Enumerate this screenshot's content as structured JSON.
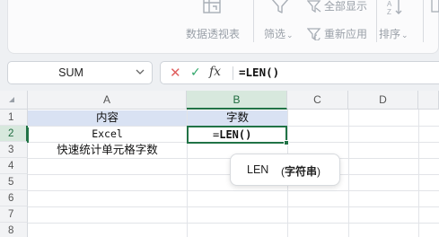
{
  "ribbon": {
    "pivot_label": "数据透视表",
    "filter_label": "筛选",
    "show_all_label": "全部显示",
    "reapply_label": "重新应用",
    "sort_label": "排序",
    "dropdown_glyph": "⌄"
  },
  "formula_bar": {
    "name_box": "SUM",
    "cancel_glyph": "✕",
    "enter_glyph": "✓",
    "fx_label": "fx",
    "formula": "=LEN()"
  },
  "grid": {
    "columns": [
      "A",
      "B",
      "C",
      "D"
    ],
    "rows": [
      "1",
      "2",
      "3",
      "4",
      "5",
      "6",
      "7",
      "8"
    ],
    "cells": {
      "A1": "内容",
      "B1": "字数",
      "A2": "Excel",
      "A3": "快速统计单元格字数"
    },
    "active_cell": {
      "ref": "B2",
      "prefix": "=",
      "func": "LEN",
      "parens": "()"
    }
  },
  "tooltip": {
    "func": "LEN",
    "arg_open": "(",
    "arg": "字符串",
    "arg_close": ")"
  },
  "colors": {
    "accent_green": "#217346",
    "header_fill": "#d9e2f3",
    "cancel_red": "#e06060",
    "enter_green": "#2fa66a"
  }
}
